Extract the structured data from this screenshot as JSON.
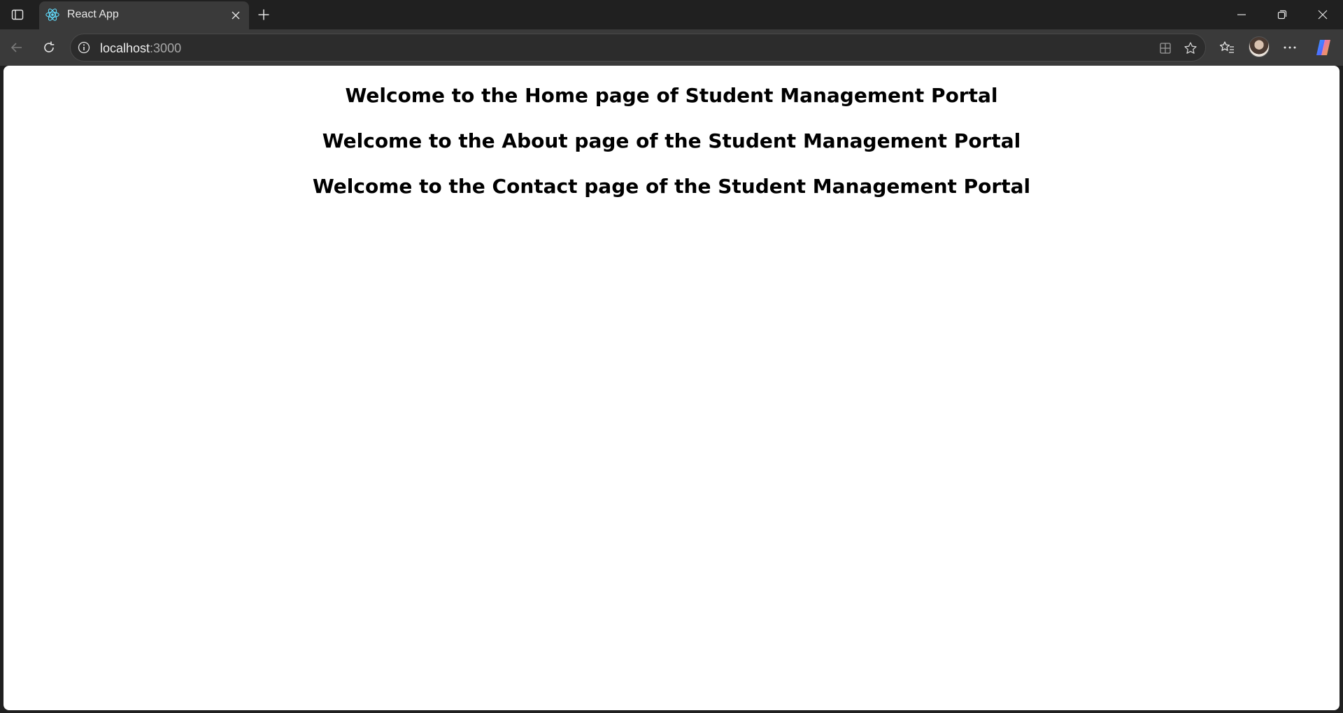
{
  "browser": {
    "tab": {
      "title": "React App",
      "favicon": "react-logo-icon"
    },
    "address_bar": {
      "host": "localhost",
      "port": ":3000"
    },
    "icons": {
      "tab_actions": "tab-actions-icon",
      "close_tab": "close-icon",
      "new_tab": "plus-icon",
      "minimize": "minimize-icon",
      "restore": "restore-icon",
      "close_window": "close-icon",
      "back": "back-arrow-icon",
      "refresh": "refresh-icon",
      "site_info": "info-icon",
      "apps": "apps-icon",
      "favorite": "star-icon",
      "favorites_list": "favorites-icon",
      "profile": "avatar",
      "more": "more-icon",
      "copilot": "copilot-icon"
    },
    "colors": {
      "chrome": "#202020",
      "toolbar": "#3a3a3a",
      "react_accent": "#61dafb"
    }
  },
  "page": {
    "headings": {
      "home": "Welcome to the Home page of Student Management Portal",
      "about": "Welcome to the About page of the Student Management Portal",
      "contact": "Welcome to the Contact page of the Student Management Portal"
    }
  }
}
